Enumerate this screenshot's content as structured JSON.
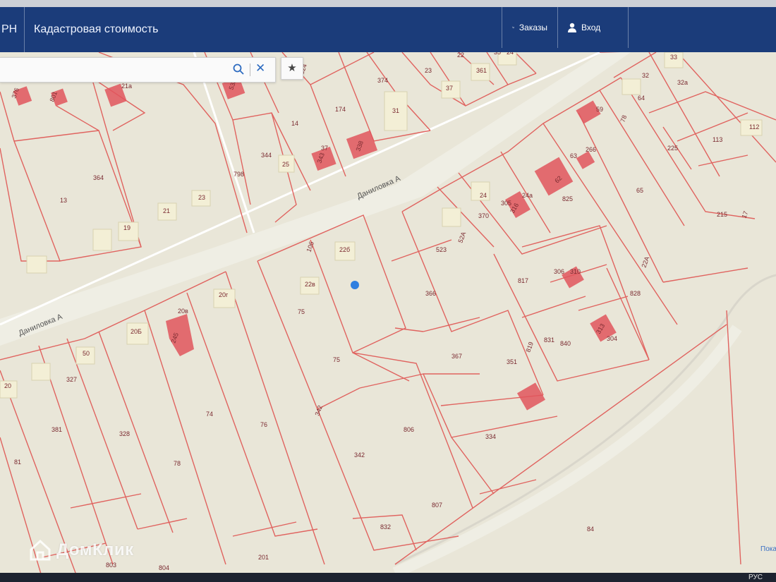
{
  "header": {
    "brand_fragment": "РН",
    "title": "Кадастровая стоимость",
    "orders_label": "Заказы",
    "login_label": "Вход"
  },
  "search": {
    "placeholder": "",
    "value": ""
  },
  "watermark": {
    "text": "ДомКлик",
    "center_text": ""
  },
  "side_link": "Показ",
  "taskbar": {
    "lang": "РУС"
  },
  "colors": {
    "header": "#1b3c7a",
    "map_bg": "#e9e6d8",
    "boundary": "#e0635f",
    "building": "#e0555d",
    "label": "#7a2a30",
    "marker": "#2f7fe0"
  },
  "map": {
    "streets": [
      "Даниловка А",
      "Даниловка А"
    ],
    "labels": [
      "376",
      "801",
      "21а",
      "320",
      "538",
      "324",
      "174",
      "374",
      "23",
      "22",
      "361",
      "35",
      "24",
      "37",
      "33",
      "32",
      "32а",
      "59",
      "64",
      "78",
      "112",
      "113",
      "31",
      "14",
      "37",
      "338",
      "343",
      "798",
      "344",
      "25",
      "63",
      "266",
      "225",
      "65",
      "215",
      "17",
      "62",
      "825",
      "364",
      "13",
      "21",
      "23",
      "19",
      "24",
      "370",
      "305",
      "316",
      "24а",
      "523",
      "52А",
      "10б",
      "22б",
      "22в",
      "75",
      "366",
      "817",
      "306",
      "310",
      "22А",
      "828",
      "20г",
      "20в",
      "20Б",
      "245",
      "50",
      "20",
      "327",
      "367",
      "351",
      "831",
      "819",
      "840",
      "304",
      "313",
      "75",
      "342",
      "74",
      "76",
      "381",
      "328",
      "806",
      "334",
      "81",
      "78",
      "342",
      "807",
      "832",
      "84",
      "803",
      "804",
      "201"
    ]
  }
}
